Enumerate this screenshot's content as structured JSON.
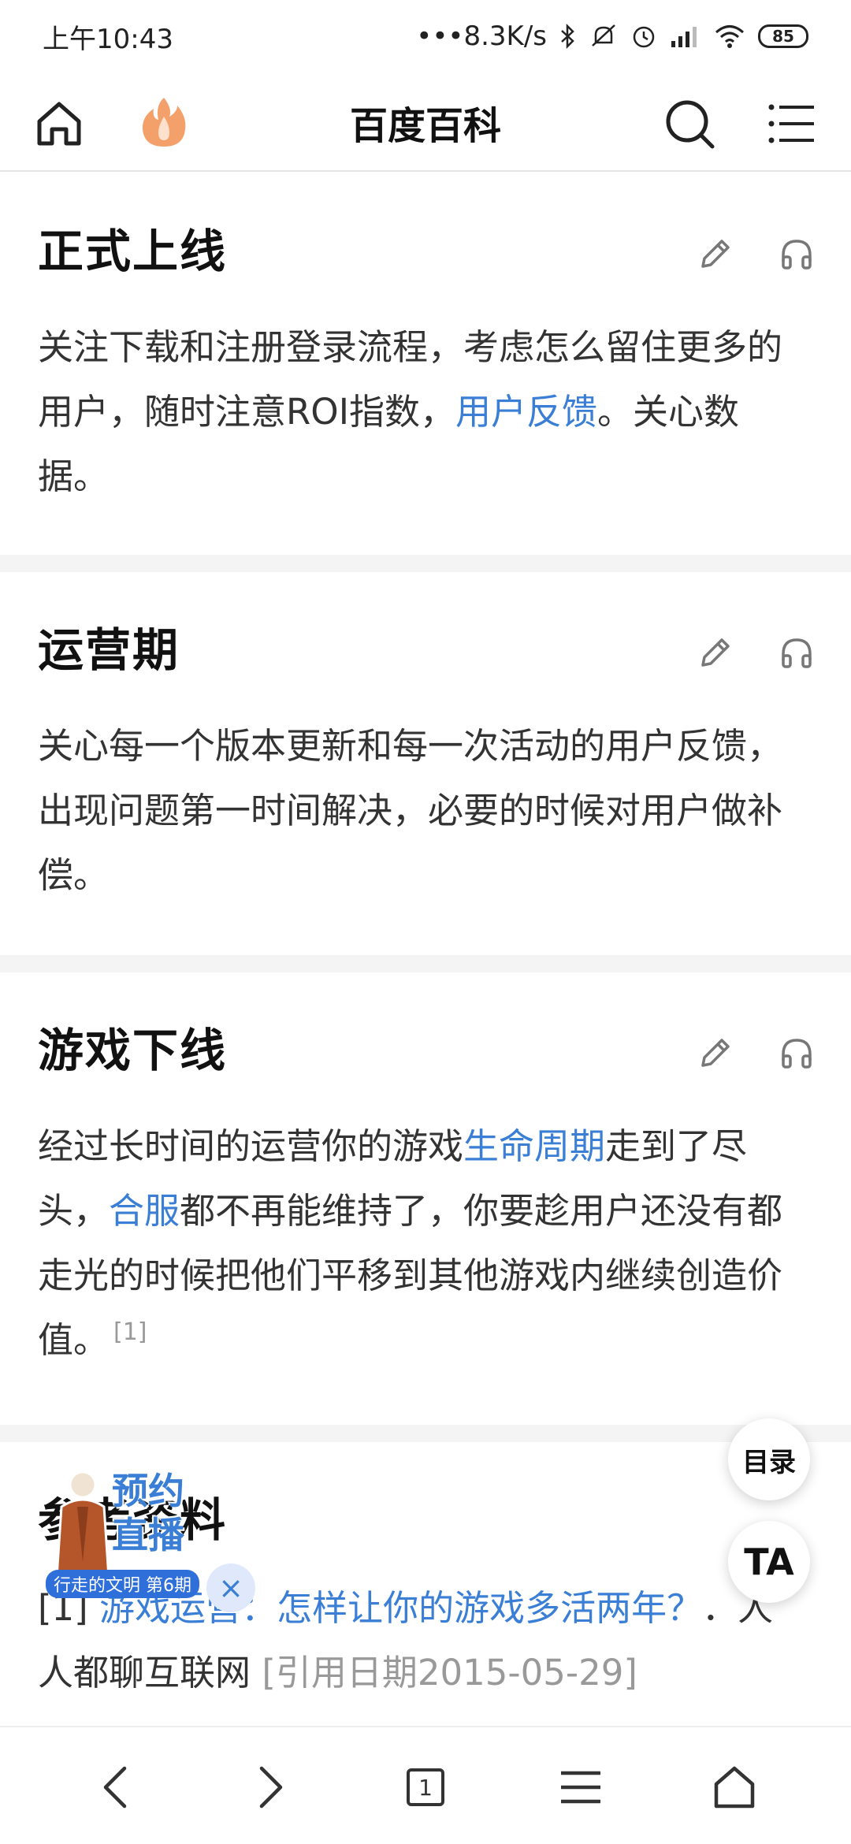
{
  "status_bar": {
    "time": "上午10:43",
    "network_speed": "•••8.3K/s",
    "battery": "85"
  },
  "header": {
    "title": "百度百科"
  },
  "sections": [
    {
      "title": "正式上线",
      "body_parts": [
        {
          "text": "关注下载和注册登录流程，考虑怎么留住更多的用户，随时注意ROI指数，",
          "link": false
        },
        {
          "text": "用户反馈",
          "link": true
        },
        {
          "text": "。关心数据。",
          "link": false
        }
      ]
    },
    {
      "title": "运营期",
      "body_parts": [
        {
          "text": "关心每一个版本更新和每一次活动的用户反馈，出现问题第一时间解决，必要的时候对用户做补偿。",
          "link": false
        }
      ]
    },
    {
      "title": "游戏下线",
      "body_parts": [
        {
          "text": "经过长时间的运营你的游戏",
          "link": false
        },
        {
          "text": "生命周期",
          "link": true
        },
        {
          "text": "走到了尽头，",
          "link": false
        },
        {
          "text": "合服",
          "link": true
        },
        {
          "text": "都不再能维持了，你要趁用户还没有都走光的时候把他们平移到其他游戏内继续创造价值。",
          "link": false
        }
      ],
      "citation": "[1]"
    }
  ],
  "references": {
    "title_fragment": "参考资料",
    "item_index": "[1]",
    "item_link": "游戏运营：怎样让你的游戏多活两年？",
    "item_source": "．人人都聊互联网",
    "item_date": "[引用日期2015-05-29]"
  },
  "floating": {
    "toc_label": "目录",
    "ta_label": "TA"
  },
  "live_promo": {
    "text": "预约直播",
    "badge": "行走的文明 第6期",
    "close": "×"
  },
  "bottom_nav": {
    "tab_count": "1"
  },
  "colors": {
    "link": "#3a7fd5",
    "divider": "#f4f4f4"
  }
}
